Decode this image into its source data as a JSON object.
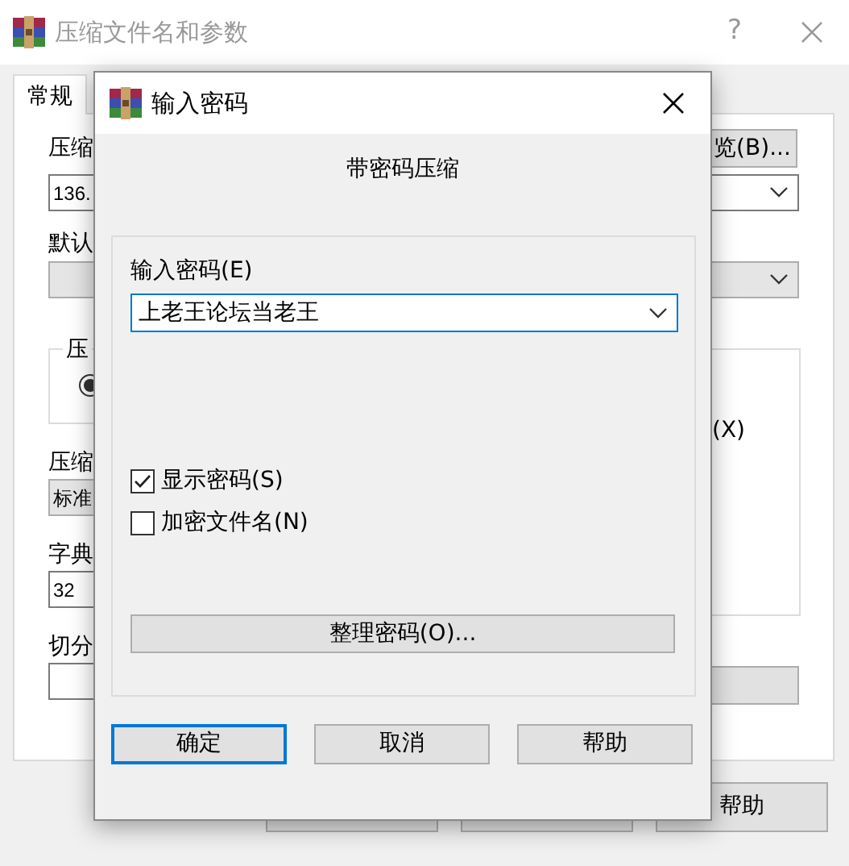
{
  "background_window": {
    "title": "压缩文件名和参数",
    "help_button": "?",
    "tabs": [
      {
        "label": "常规",
        "selected": true
      }
    ],
    "archive_label": "压缩",
    "browse_button": "览(B)...",
    "archive_value": "136.",
    "profile_label": "默认",
    "format_group_label": "压",
    "format_radio": {
      "selected": true
    },
    "option_text": "(X)",
    "method_label": "压缩",
    "method_value": "标准",
    "dictionary_label": "字典",
    "dictionary_value": "32",
    "split_label": "切分",
    "buttons": [
      "帮助"
    ]
  },
  "dialog": {
    "title": "输入密码",
    "heading": "带密码压缩",
    "password_label": "输入密码(E)",
    "password_value": "上老王论坛当老王",
    "options": [
      {
        "label": "显示密码(S)",
        "checked": true
      },
      {
        "label": "加密文件名(N)",
        "checked": false
      }
    ],
    "organize_button": "整理密码(O)...",
    "buttons": [
      {
        "label": "确定",
        "default": true
      },
      {
        "label": "取消",
        "default": false
      },
      {
        "label": "帮助",
        "default": false
      }
    ]
  }
}
